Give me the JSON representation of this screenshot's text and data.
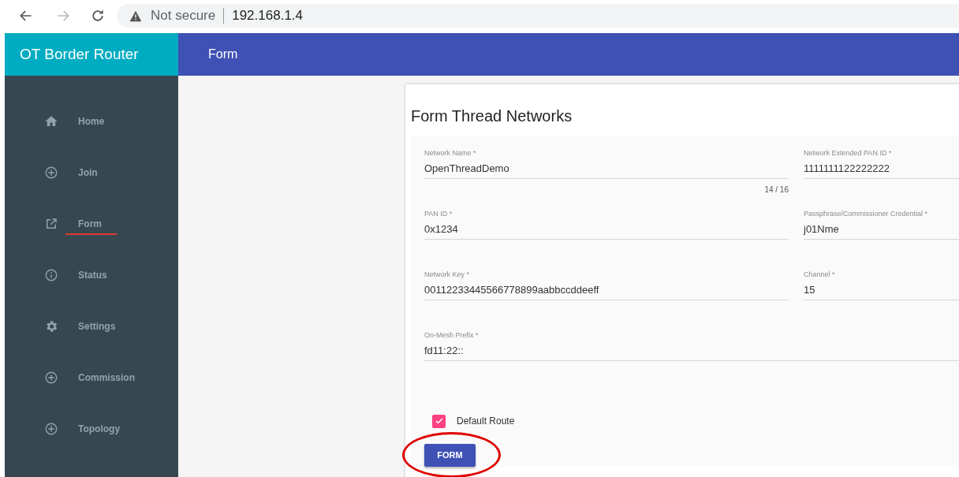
{
  "browser": {
    "security": "Not secure",
    "url": "192.168.1.4"
  },
  "app": {
    "title": "OT Border Router",
    "page_title": "Form"
  },
  "sidebar": {
    "items": [
      {
        "label": "Home",
        "kind": "home",
        "underlined": false
      },
      {
        "label": "Join",
        "kind": "plus",
        "underlined": false
      },
      {
        "label": "Form",
        "kind": "external",
        "underlined": true
      },
      {
        "label": "Status",
        "kind": "info",
        "underlined": false
      },
      {
        "label": "Settings",
        "kind": "gear",
        "underlined": false
      },
      {
        "label": "Commission",
        "kind": "plus",
        "underlined": false
      },
      {
        "label": "Topology",
        "kind": "plus",
        "underlined": false
      }
    ]
  },
  "form": {
    "title": "Form Thread Networks",
    "rows": [
      [
        {
          "label": "Network Name *",
          "value": "OpenThreadDemo",
          "counter": "14 / 16"
        },
        {
          "label": "Network Extended PAN ID *",
          "value": "1111111122222222"
        }
      ],
      [
        {
          "label": "PAN ID *",
          "value": "0x1234"
        },
        {
          "label": "Passphrase/Commissioner Credential *",
          "value": "j01Nme"
        }
      ],
      [
        {
          "label": "Network Key *",
          "value": "00112233445566778899aabbccddeeff"
        },
        {
          "label": "Channel *",
          "value": "15"
        }
      ],
      [
        {
          "label": "On-Mesh Prefix *",
          "value": "fd11:22::"
        }
      ]
    ],
    "checkbox": {
      "label": "Default Route",
      "checked": true
    },
    "button": {
      "label": "FORM",
      "circled": true
    }
  }
}
